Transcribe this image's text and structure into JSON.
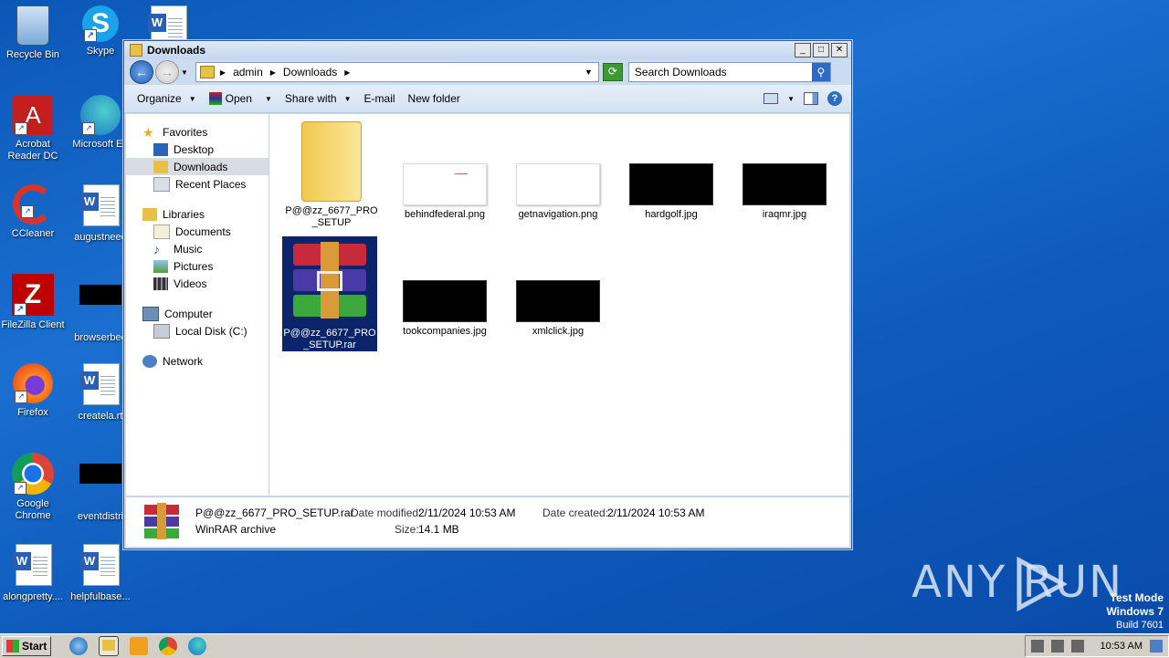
{
  "desktop": {
    "icons": [
      {
        "label": "Recycle Bin"
      },
      {
        "label": "Skype"
      },
      {
        "label": "Acrobat Reader DC"
      },
      {
        "label": "Microsoft Ed"
      },
      {
        "label": "CCleaner"
      },
      {
        "label": "augustneed"
      },
      {
        "label": "FileZilla Client"
      },
      {
        "label": "browserbee"
      },
      {
        "label": "Firefox"
      },
      {
        "label": "createla.rt"
      },
      {
        "label": "Google Chrome"
      },
      {
        "label": "eventdistri"
      },
      {
        "label": "alongpretty...."
      },
      {
        "label": "helpfulbase..."
      }
    ],
    "watermark": "ANY RUN",
    "os_info": {
      "line1": "Test Mode",
      "line2": "Windows 7",
      "line3": "Build 7601"
    }
  },
  "window": {
    "title": "Downloads",
    "address": {
      "crumbs": [
        "admin",
        "Downloads"
      ]
    },
    "search_placeholder": "Search Downloads",
    "toolbar": {
      "organize": "Organize",
      "open": "Open",
      "share": "Share with",
      "email": "E-mail",
      "new_folder": "New folder"
    },
    "nav": {
      "favorites": "Favorites",
      "desktop": "Desktop",
      "downloads": "Downloads",
      "recent": "Recent Places",
      "libraries": "Libraries",
      "documents": "Documents",
      "music": "Music",
      "pictures": "Pictures",
      "videos": "Videos",
      "computer": "Computer",
      "localdisk": "Local Disk (C:)",
      "network": "Network"
    },
    "files": [
      {
        "name": "P@@zz_6677_PRO_SETUP"
      },
      {
        "name": "behindfederal.png"
      },
      {
        "name": "getnavigation.png"
      },
      {
        "name": "hardgolf.jpg"
      },
      {
        "name": "iraqmr.jpg"
      },
      {
        "name": "P@@zz_6677_PRO_SETUP.rar"
      },
      {
        "name": "tookcompanies.jpg"
      },
      {
        "name": "xmlclick.jpg"
      }
    ],
    "status": {
      "filename": "P@@zz_6677_PRO_SETUP.rar",
      "type": "WinRAR archive",
      "modified_label": "Date modified:",
      "modified": "2/11/2024 10:53 AM",
      "created_label": "Date created:",
      "created": "2/11/2024 10:53 AM",
      "size_label": "Size:",
      "size": "14.1 MB"
    }
  },
  "taskbar": {
    "start": "Start",
    "clock": "10:53 AM"
  }
}
